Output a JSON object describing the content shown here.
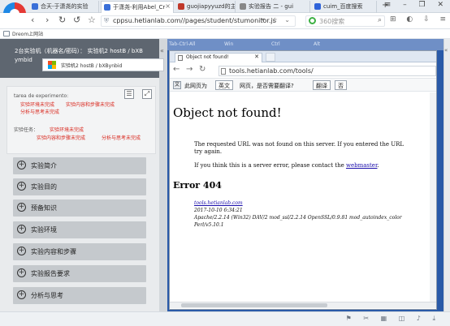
{
  "browser": {
    "tabs": [
      {
        "label": "合天-于潇尧的实验",
        "active": false
      },
      {
        "label": "于潇尧-利用Abel_Cr",
        "active": true
      },
      {
        "label": "guojiapyyuzd的主页",
        "active": false
      },
      {
        "label": "实验报告 二 - gui",
        "active": false
      },
      {
        "label": "cuim_百度搜索",
        "active": false
      }
    ],
    "window_controls": "≡ – ❐ ✕",
    "url": "cppsu.hetianlab.com//pages/student/stumonitor.js",
    "search_placeholder": "360搜索",
    "bookmark": "Dreom上网站"
  },
  "lab": {
    "header_line1": "2台实验机（机器名/密码）：  实验机2   hostB / bXB",
    "header_line2": "ymbid",
    "vm_tab": "实验机2   hostB / bXBynbid",
    "tarea_label": "tarea de experimento:",
    "steps_line1": [
      "实验环境未完成",
      "实验内容和步骤未完成"
    ],
    "steps_line2": "分析与思考未完成",
    "task_label": "实验任务：",
    "task_line1": "实验环境未完成",
    "task_line2": [
      "实验内容和步骤未完成",
      "分析与思考未完成"
    ],
    "sections": [
      "实验简介",
      "实验目的",
      "预备知识",
      "实验环境",
      "实验内容和步骤",
      "实验报告要求",
      "分析与思考"
    ]
  },
  "remote_top": [
    "Tab-Ctrl-All",
    "Win",
    "Ctrl",
    "Alt"
  ],
  "ie": {
    "tab_title": "Object not found!",
    "address": "tools.hetianlab.com/tools/",
    "translate_prefix": "此网页为",
    "translate_lang": "英文",
    "translate_mid": "网页，是否需要翻译?",
    "translate_yes": "翻译",
    "translate_no": "否",
    "page": {
      "title": "Object not found!",
      "para1_line1": "The requested URL was not found on this server. If you entered the URL",
      "para1_line2": "try again.",
      "para2_prefix": "If you think this is a server error, please contact the",
      "para2_link": "webmaster",
      "para2_suffix": ".",
      "error_heading": "Error 404",
      "server_host": "tools.hetianlab.com",
      "date": "2017-10-10 6:34:21",
      "server_sig": "Apache/2.2.14 (Win32) DAV/2 mod_ssl/2.2.14 OpenSSL/0.9.81 mod_autoindex_color",
      "php": "Perl/v5.10.1"
    }
  }
}
